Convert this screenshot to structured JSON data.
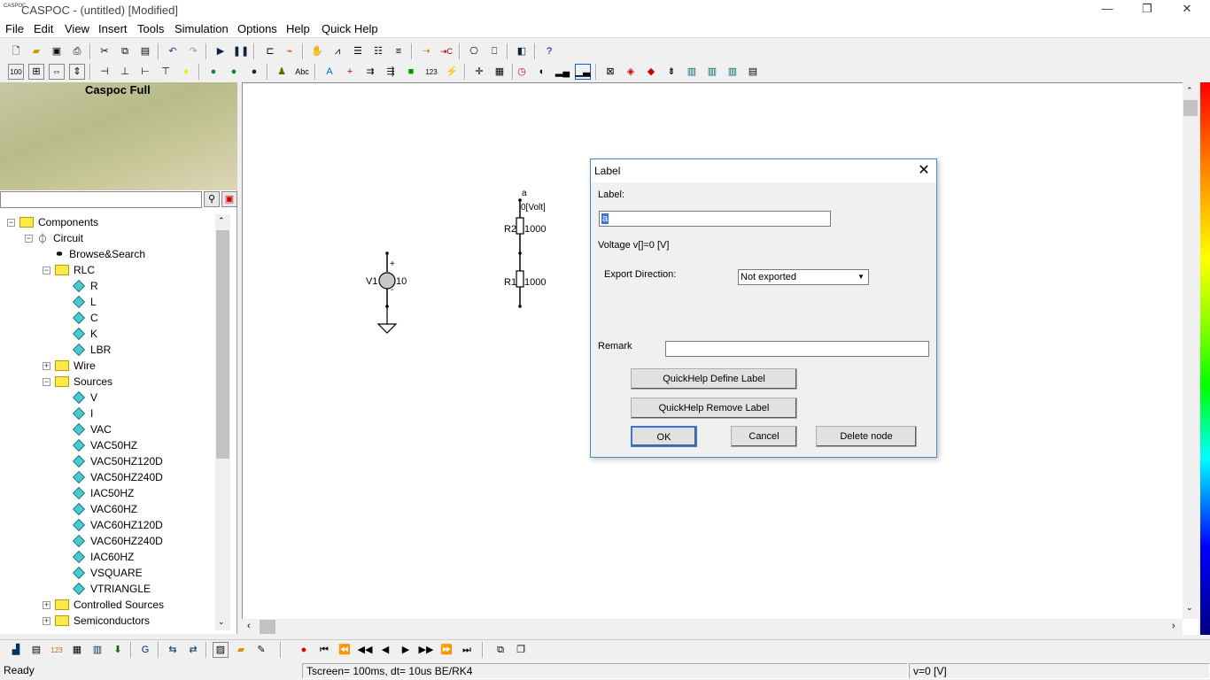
{
  "window": {
    "icon_text": "CASPOC",
    "title": "CASPOC - (untitled) [Modified]",
    "minimize": "—",
    "restore": "❐",
    "close": "✕"
  },
  "menu": [
    "File",
    "Edit",
    "View",
    "Insert",
    "Tools",
    "Simulation",
    "Options",
    "Help",
    "Quick Help"
  ],
  "toolbar1_icons": [
    "new-icon",
    "open-icon",
    "save-icon",
    "print-icon",
    "cut-icon",
    "copy-icon",
    "paste-icon",
    "undo-icon",
    "redo-icon",
    "run-icon",
    "pause-icon",
    "wire-icon",
    "probe-icon",
    "hand-icon",
    "scope-icon",
    "list-icon",
    "list2-icon",
    "list3-icon",
    "ic-icon",
    "ic2-icon",
    "camera-icon",
    "camera2-icon",
    "flip-icon",
    "help-icon"
  ],
  "toolbar2_icons": [
    "zoom-100-icon",
    "fit-icon",
    "h-icon",
    "v-icon",
    "node-icon",
    "node2-icon",
    "node3-icon",
    "node4-icon",
    "lamp-icon",
    "globe-icon",
    "globe2-icon",
    "globe3-icon",
    "person-icon",
    "text-icon",
    "abc-icon",
    "cross-icon",
    "arrow-icon",
    "arrow2-icon",
    "block-icon",
    "num-icon",
    "meter-icon",
    "plus-icon",
    "grid-icon",
    "clock-icon",
    "scope3-icon",
    "bar-icon",
    "bar2-icon",
    "rect-icon",
    "rect2-icon",
    "rect3-icon",
    "rect4-icon",
    "chip-icon",
    "chip2-icon",
    "chip3-icon",
    "table-icon"
  ],
  "banner": {
    "title": "Caspoc Full"
  },
  "search": {
    "value": "",
    "placeholder": ""
  },
  "tree": [
    {
      "label": "Components",
      "icon": "folder",
      "level": 0,
      "expander": "−"
    },
    {
      "label": "Circuit",
      "icon": "probe",
      "level": 1,
      "expander": "−"
    },
    {
      "label": "Browse&Search",
      "icon": "binoculars",
      "level": 2,
      "expander": ""
    },
    {
      "label": "RLC",
      "icon": "folder",
      "level": 2,
      "expander": "−"
    },
    {
      "label": "R",
      "icon": "diamond",
      "level": 3,
      "expander": ""
    },
    {
      "label": "L",
      "icon": "diamond",
      "level": 3,
      "expander": ""
    },
    {
      "label": "C",
      "icon": "diamond",
      "level": 3,
      "expander": ""
    },
    {
      "label": "K",
      "icon": "diamond",
      "level": 3,
      "expander": ""
    },
    {
      "label": "LBR",
      "icon": "diamond",
      "level": 3,
      "expander": ""
    },
    {
      "label": "Wire",
      "icon": "folder",
      "level": 2,
      "expander": "+"
    },
    {
      "label": "Sources",
      "icon": "folder",
      "level": 2,
      "expander": "−"
    },
    {
      "label": "V",
      "icon": "diamond",
      "level": 3,
      "expander": ""
    },
    {
      "label": "I",
      "icon": "diamond",
      "level": 3,
      "expander": ""
    },
    {
      "label": "VAC",
      "icon": "diamond",
      "level": 3,
      "expander": ""
    },
    {
      "label": "VAC50HZ",
      "icon": "diamond",
      "level": 3,
      "expander": ""
    },
    {
      "label": "VAC50HZ120D",
      "icon": "diamond",
      "level": 3,
      "expander": ""
    },
    {
      "label": "VAC50HZ240D",
      "icon": "diamond",
      "level": 3,
      "expander": ""
    },
    {
      "label": "IAC50HZ",
      "icon": "diamond",
      "level": 3,
      "expander": ""
    },
    {
      "label": "VAC60HZ",
      "icon": "diamond",
      "level": 3,
      "expander": ""
    },
    {
      "label": "VAC60HZ120D",
      "icon": "diamond",
      "level": 3,
      "expander": ""
    },
    {
      "label": "VAC60HZ240D",
      "icon": "diamond",
      "level": 3,
      "expander": ""
    },
    {
      "label": "IAC60HZ",
      "icon": "diamond",
      "level": 3,
      "expander": ""
    },
    {
      "label": "VSQUARE",
      "icon": "diamond",
      "level": 3,
      "expander": ""
    },
    {
      "label": "VTRIANGLE",
      "icon": "diamond",
      "level": 3,
      "expander": ""
    },
    {
      "label": "Controlled Sources",
      "icon": "folder",
      "level": 2,
      "expander": "+"
    },
    {
      "label": "Semiconductors",
      "icon": "folder",
      "level": 2,
      "expander": "+"
    }
  ],
  "schematic": {
    "v1": {
      "name": "V1",
      "value": "10",
      "plus": "+",
      "minus": "-"
    },
    "r1": {
      "name": "R1",
      "value": "1000"
    },
    "r2": {
      "name": "R2",
      "value": "1000"
    },
    "node": {
      "label": "a",
      "readout": "0[Volt]"
    }
  },
  "dialog": {
    "title": "Label",
    "close": "✕",
    "label_caption": "Label:",
    "label_value": "a",
    "voltage_text": "Voltage v[]=0 [V]",
    "export_caption": "Export Direction:",
    "export_value": "Not exported",
    "remark_caption": "Remark",
    "remark_value": "",
    "qh_define": "QuickHelp Define Label",
    "qh_remove": "QuickHelp Remove Label",
    "ok": "OK",
    "cancel": "Cancel",
    "delete": "Delete node"
  },
  "status": {
    "ready": "Ready",
    "timing": "Tscreen= 100ms, dt= 10us BE/RK4",
    "voltage": "v=0 [V]"
  }
}
